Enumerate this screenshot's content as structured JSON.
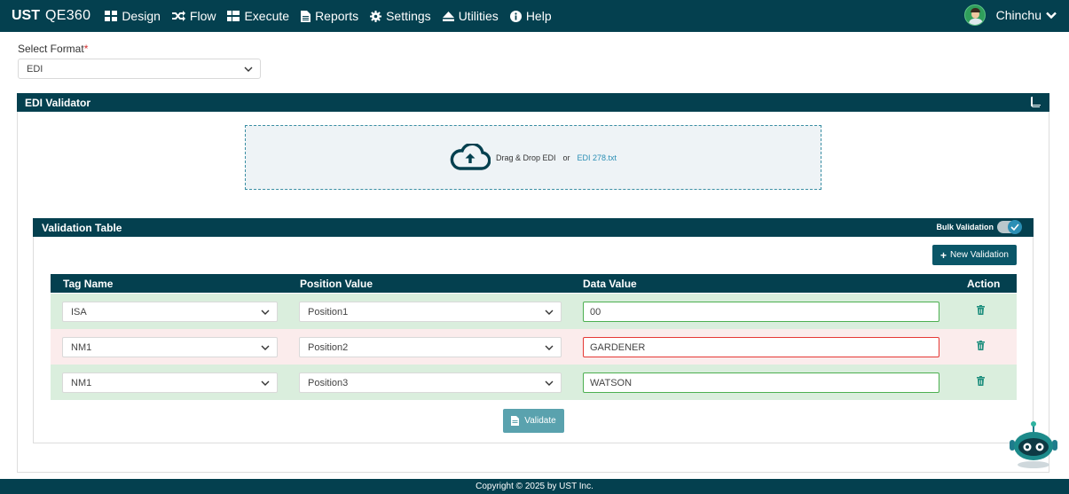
{
  "brand": {
    "name_bold": "UST",
    "name_light": "QE360"
  },
  "nav": [
    {
      "label": "Design",
      "icon": "grid-icon"
    },
    {
      "label": "Flow",
      "icon": "shuffle-icon"
    },
    {
      "label": "Execute",
      "icon": "list-icon"
    },
    {
      "label": "Reports",
      "icon": "document-icon"
    },
    {
      "label": "Settings",
      "icon": "gear-icon"
    },
    {
      "label": "Utilities",
      "icon": "eject-icon"
    },
    {
      "label": "Help",
      "icon": "info-icon"
    }
  ],
  "user": {
    "name": "Chinchu"
  },
  "format": {
    "label": "Select Format",
    "required_mark": "*",
    "value": "EDI"
  },
  "validator": {
    "title": "EDI Validator",
    "dropzone": {
      "text": "Drag & Drop EDI",
      "or": "or",
      "file_name": "EDI 278.txt"
    }
  },
  "validation_table": {
    "title": "Validation Table",
    "bulk_label": "Bulk Validation",
    "bulk_enabled": true,
    "new_button": "New Validation",
    "columns": {
      "tag": "Tag Name",
      "position": "Position Value",
      "data": "Data Value",
      "action": "Action"
    },
    "rows": [
      {
        "tag": "ISA",
        "position": "Position1",
        "data": "00",
        "status": "valid"
      },
      {
        "tag": "NM1",
        "position": "Position2",
        "data": "GARDENER",
        "status": "invalid"
      },
      {
        "tag": "NM1",
        "position": "Position3",
        "data": "WATSON",
        "status": "valid"
      }
    ],
    "validate_button": "Validate"
  },
  "footer": {
    "text": "Copyright © 2025 by UST Inc."
  },
  "colors": {
    "nav_bg": "#04404f",
    "accent": "#2b8fb5",
    "valid_row": "#daeedd",
    "invalid_row": "#fbecec",
    "valid_border": "#4caf50",
    "invalid_border": "#e53935"
  }
}
